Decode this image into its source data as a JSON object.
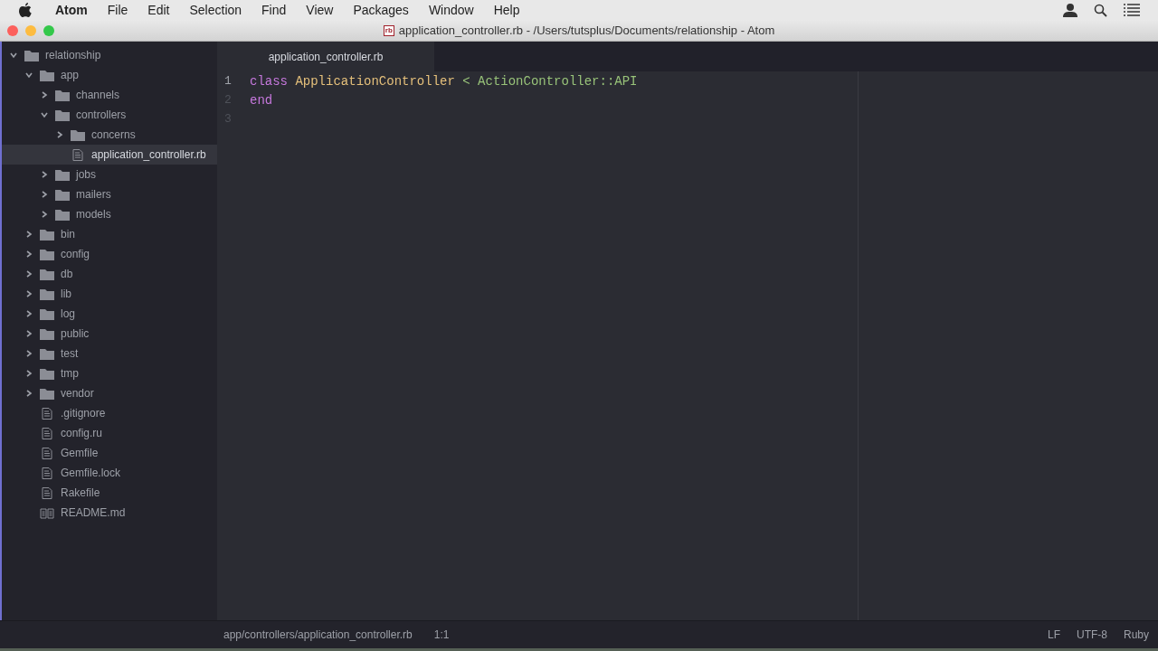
{
  "menu_bar": {
    "app_name": "Atom",
    "items": [
      "File",
      "Edit",
      "Selection",
      "Find",
      "View",
      "Packages",
      "Window",
      "Help"
    ]
  },
  "window": {
    "title": "application_controller.rb - /Users/tutsplus/Documents/relationship - Atom",
    "file_badge": "rb"
  },
  "tree": [
    {
      "name": "relationship",
      "kind": "folder",
      "expanded": true,
      "selected": false,
      "children": [
        {
          "name": "app",
          "kind": "folder",
          "expanded": true,
          "selected": false,
          "children": [
            {
              "name": "channels",
              "kind": "folder",
              "expanded": false,
              "selected": false
            },
            {
              "name": "controllers",
              "kind": "folder",
              "expanded": true,
              "selected": false,
              "children": [
                {
                  "name": "concerns",
                  "kind": "folder",
                  "expanded": false,
                  "selected": false
                },
                {
                  "name": "application_controller.rb",
                  "kind": "file",
                  "selected": true
                }
              ]
            },
            {
              "name": "jobs",
              "kind": "folder",
              "expanded": false,
              "selected": false
            },
            {
              "name": "mailers",
              "kind": "folder",
              "expanded": false,
              "selected": false
            },
            {
              "name": "models",
              "kind": "folder",
              "expanded": false,
              "selected": false
            }
          ]
        },
        {
          "name": "bin",
          "kind": "folder",
          "expanded": false,
          "selected": false
        },
        {
          "name": "config",
          "kind": "folder",
          "expanded": false,
          "selected": false
        },
        {
          "name": "db",
          "kind": "folder",
          "expanded": false,
          "selected": false
        },
        {
          "name": "lib",
          "kind": "folder",
          "expanded": false,
          "selected": false
        },
        {
          "name": "log",
          "kind": "folder",
          "expanded": false,
          "selected": false
        },
        {
          "name": "public",
          "kind": "folder",
          "expanded": false,
          "selected": false
        },
        {
          "name": "test",
          "kind": "folder",
          "expanded": false,
          "selected": false
        },
        {
          "name": "tmp",
          "kind": "folder",
          "expanded": false,
          "selected": false
        },
        {
          "name": "vendor",
          "kind": "folder",
          "expanded": false,
          "selected": false
        },
        {
          "name": ".gitignore",
          "kind": "file",
          "selected": false
        },
        {
          "name": "config.ru",
          "kind": "file",
          "selected": false
        },
        {
          "name": "Gemfile",
          "kind": "file",
          "selected": false
        },
        {
          "name": "Gemfile.lock",
          "kind": "file",
          "selected": false
        },
        {
          "name": "Rakefile",
          "kind": "file",
          "selected": false
        },
        {
          "name": "README.md",
          "kind": "readme",
          "selected": false
        }
      ]
    }
  ],
  "tabs": [
    {
      "label": "application_controller.rb",
      "selected": true
    }
  ],
  "code_lines": [
    {
      "number": "1",
      "current": true,
      "tokens": [
        {
          "text": "class",
          "kind": "keyword"
        },
        {
          "text": " ApplicationController",
          "kind": "class"
        },
        {
          "text": " < ",
          "kind": "operator"
        },
        {
          "text": "ActionController::API",
          "kind": "inherited"
        }
      ]
    },
    {
      "number": "2",
      "current": false,
      "tokens": [
        {
          "text": "end",
          "kind": "keyword"
        }
      ]
    },
    {
      "number": "3",
      "current": false
    }
  ],
  "status_bar": {
    "path": "app/controllers/application_controller.rb",
    "cursor": "1:1",
    "line_ending": "LF",
    "encoding": "UTF-8",
    "grammar": "Ruby"
  }
}
